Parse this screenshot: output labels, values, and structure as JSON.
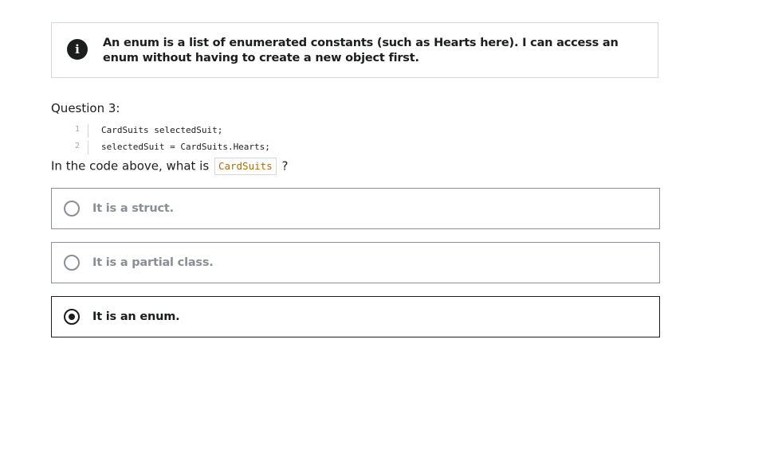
{
  "info": {
    "icon": "info-icon",
    "icon_glyph": "i",
    "text": "An enum is a list of enumerated constants (such as Hearts here). I can access an enum without having to create a new object first."
  },
  "question": {
    "label": "Question 3:",
    "code_lines": [
      {
        "number": "1",
        "code": "CardSuits selectedSuit;"
      },
      {
        "number": "2",
        "code": "selectedSuit = CardSuits.Hearts;"
      }
    ],
    "prompt_before": "In the code above, what is",
    "prompt_code": "CardSuits",
    "prompt_after": "?"
  },
  "options": [
    {
      "label": "It is a struct.",
      "selected": false
    },
    {
      "label": "It is a partial class.",
      "selected": false
    },
    {
      "label": "It is an enum.",
      "selected": true
    }
  ],
  "colors": {
    "text": "#1c1d1f",
    "muted": "#8a8f95",
    "border": "#d1d7dc",
    "code_accent": "#b4690e"
  }
}
